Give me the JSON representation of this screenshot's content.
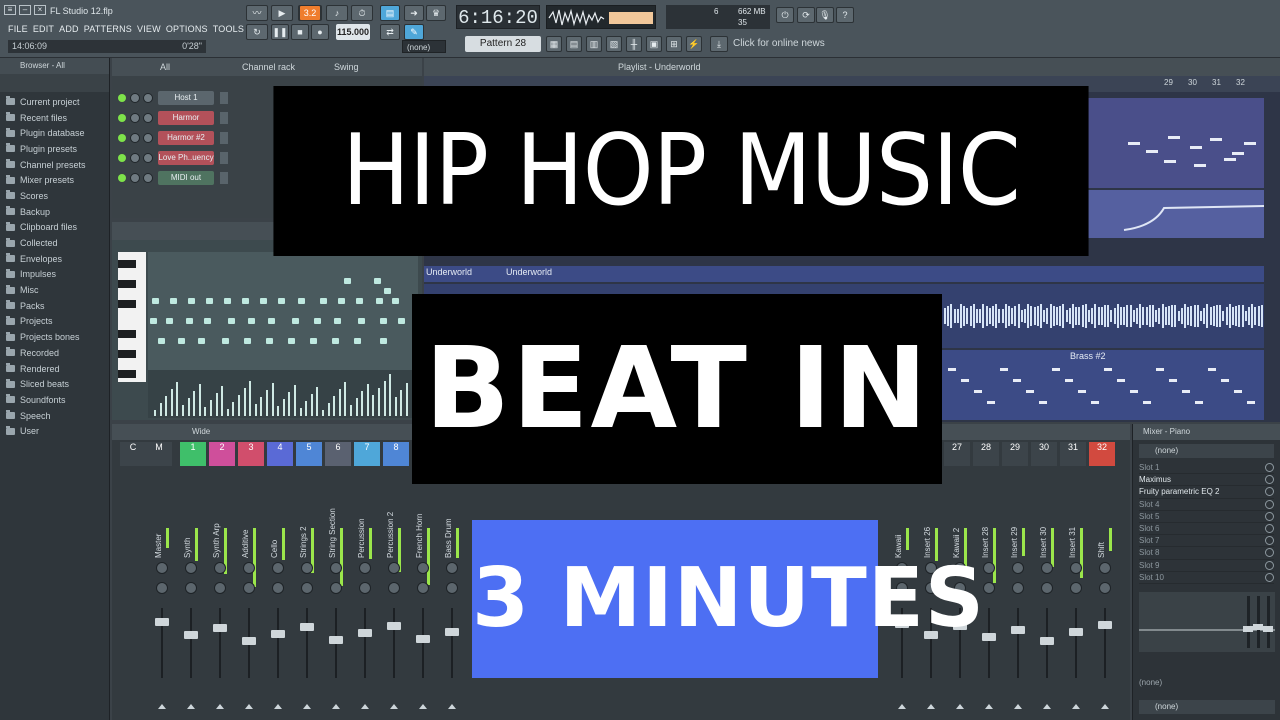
{
  "app": {
    "window_title": "FL Studio 12.flp",
    "menu": [
      "FILE",
      "EDIT",
      "ADD",
      "PATTERNS",
      "VIEW",
      "OPTIONS",
      "TOOLS",
      "?"
    ],
    "hint_left": "14:06:09",
    "hint_right": "0'28\"",
    "song_time": "6:16:20",
    "tempo": "115.000",
    "pattern": "Pattern 28",
    "mixer_mode": "(none)",
    "cpu_line_1": "6",
    "cpu_line_2": "662 MB",
    "cpu_line_3": "35",
    "online_news": "Click for online news"
  },
  "browser": {
    "title": "Browser - All",
    "items": [
      "Current project",
      "Recent files",
      "Plugin database",
      "Plugin presets",
      "Channel presets",
      "Mixer presets",
      "Scores",
      "Backup",
      "Clipboard files",
      "Collected",
      "Envelopes",
      "Impulses",
      "Misc",
      "Packs",
      "Projects",
      "Projects bones",
      "Recorded",
      "Rendered",
      "Sliced beats",
      "Soundfonts",
      "Speech",
      "User"
    ]
  },
  "channel_rack": {
    "title": "Channel rack",
    "filter": "All",
    "swing_label": "Swing",
    "channels": [
      {
        "name": "Host 1",
        "style": "grey"
      },
      {
        "name": "Harmor",
        "style": "red"
      },
      {
        "name": "Harmor #2",
        "style": "red"
      },
      {
        "name": "Love Ph..uency",
        "style": "red"
      },
      {
        "name": "MIDI out",
        "style": "green"
      }
    ]
  },
  "playlist": {
    "title": "Playlist - Underworld",
    "bar_numbers": [
      "29",
      "30",
      "31",
      "32"
    ],
    "clips": [
      "Underworld",
      "Underworld",
      "Brass #2"
    ]
  },
  "mixer": {
    "title": "Wide",
    "header_left": [
      "C",
      "M"
    ],
    "inserts_visible": [
      "1",
      "2",
      "3",
      "4",
      "5",
      "6",
      "7",
      "8"
    ],
    "inserts_right": [
      "27",
      "28",
      "29",
      "30",
      "31",
      "32"
    ],
    "insert_colors": [
      "#3fbf6a",
      "#cf4f9b",
      "#d14e6c",
      "#5a6ad6",
      "#4f86d6",
      "#5a6170",
      "#4fa7d9",
      "#4f86d6"
    ],
    "strips": [
      "Master",
      "Synth",
      "Synth Arp",
      "Additive",
      "Cello",
      "Strings 2",
      "String Section",
      "Percussion",
      "Percussion 2",
      "French Horn",
      "Bass Drum"
    ],
    "strips_right": [
      "Kawaii",
      "Insert 26",
      "Kawaii 2",
      "Insert 28",
      "Insert 29",
      "Insert 30",
      "Insert 31",
      "Shift"
    ]
  },
  "mixer_inserts": {
    "title": "Mixer - Piano",
    "select_value": "(none)",
    "slots": [
      {
        "label": "Slot 1",
        "active": false
      },
      {
        "label": "Maximus",
        "active": true
      },
      {
        "label": "Fruity parametric EQ 2",
        "active": true
      },
      {
        "label": "Slot 4",
        "active": false
      },
      {
        "label": "Slot 5",
        "active": false
      },
      {
        "label": "Slot 6",
        "active": false
      },
      {
        "label": "Slot 7",
        "active": false
      },
      {
        "label": "Slot 8",
        "active": false
      },
      {
        "label": "Slot 9",
        "active": false
      },
      {
        "label": "Slot 10",
        "active": false
      }
    ],
    "footer_1": "(none)",
    "footer_2": "(none)"
  },
  "overlay": {
    "line_1": "HIP HOP MUSIC",
    "line_2": "BEAT IN",
    "line_3": "3 MINUTES",
    "accent_color": "#4d6ff3"
  }
}
